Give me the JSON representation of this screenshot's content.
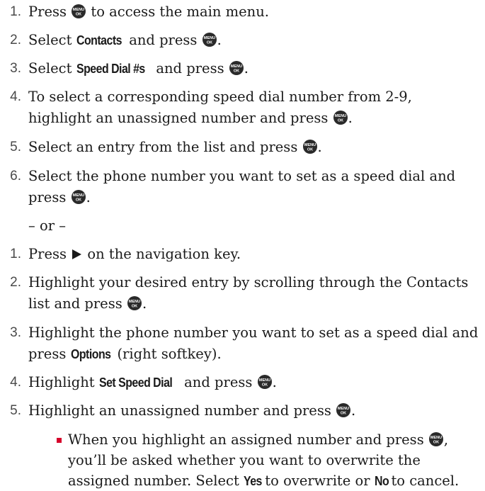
{
  "steps_a": [
    {
      "num": "1.",
      "parts": [
        "Press ",
        "@key",
        " to access the main menu."
      ]
    },
    {
      "num": "2.",
      "parts": [
        "Select ",
        "*Contacts",
        " and press ",
        "@key",
        "."
      ]
    },
    {
      "num": "3.",
      "parts": [
        "Select ",
        "*Speed Dial #s",
        " and press ",
        "@key",
        "."
      ]
    },
    {
      "num": "4.",
      "parts": [
        "To select a corresponding speed dial number from 2-9, highlight an unassigned number and press ",
        "@key",
        "."
      ]
    },
    {
      "num": "5.",
      "parts": [
        "Select an entry from the list and press ",
        "@key",
        "."
      ]
    },
    {
      "num": "6.",
      "parts": [
        "Select the phone number you want to set as a speed dial and press ",
        "@key",
        "."
      ]
    }
  ],
  "or_text": "– or –",
  "steps_b": [
    {
      "num": "1.",
      "parts": [
        "Press ",
        "@arrow",
        " on the navigation key."
      ]
    },
    {
      "num": "2.",
      "parts": [
        "Highlight your desired entry by scrolling through the Contacts list and press ",
        "@key",
        "."
      ]
    },
    {
      "num": "3.",
      "parts": [
        "Highlight the phone number you want to set as a speed dial and press ",
        "*Options",
        " (right softkey)."
      ]
    },
    {
      "num": "4.",
      "parts": [
        "Highlight ",
        "*Set Speed Dial",
        " and press ",
        "@key",
        "."
      ]
    },
    {
      "num": "5.",
      "parts": [
        "Highlight an unassigned number and press ",
        "@key",
        "."
      ]
    }
  ],
  "bullet": {
    "parts": [
      "When you highlight an assigned number and press ",
      "@key",
      ", you’ll be asked whether you want to overwrite the assigned number. Select ",
      "*Yes",
      " to overwrite or ",
      "*No",
      " to cancel."
    ]
  },
  "key_label_top": "MENU",
  "key_label_bottom": "OK",
  "colors": {
    "bullet": "#d6002a",
    "number": "#4a4a4a",
    "text": "#1a1a1a",
    "key": "#2a2a2a"
  },
  "icons": {
    "menu_key": "menu-ok-key-icon",
    "nav_right": "navigation-right-arrow-icon"
  }
}
